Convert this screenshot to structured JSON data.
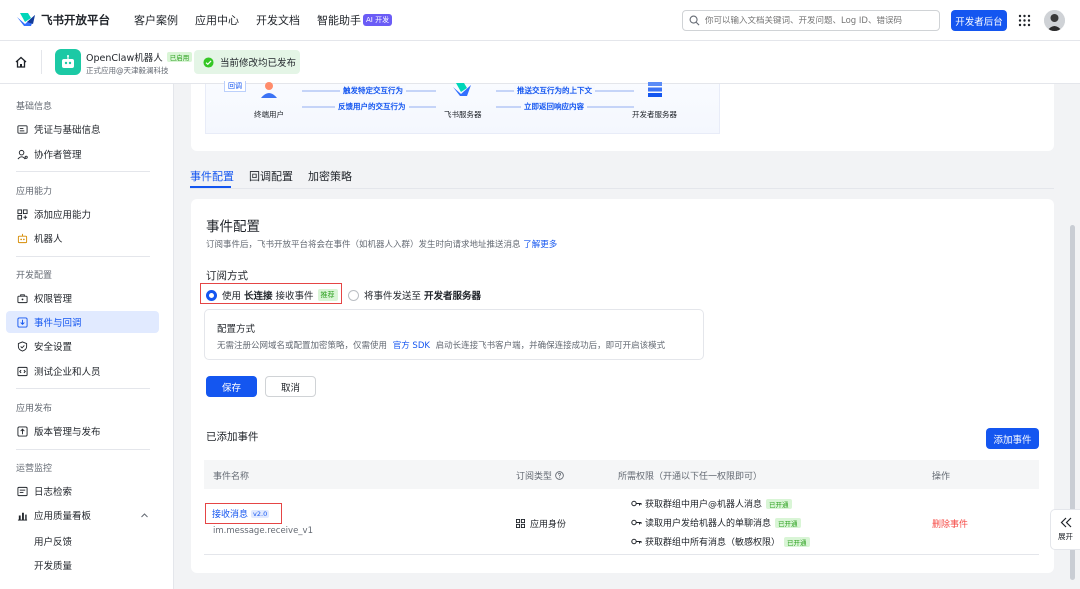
{
  "topbar": {
    "logo_text": "飞书开放平台",
    "nav": [
      "客户案例",
      "应用中心",
      "开发文档",
      "智能助手"
    ],
    "ai_badge": "AI 开发",
    "search_placeholder": "你可以输入文档关键词、开发问题、Log ID、错误码",
    "dev_console": "开发者后台"
  },
  "appbar": {
    "app_name": "OpenClaw机器人",
    "app_status": "已启用",
    "app_sub": "正式应用@天津毅澜科技",
    "publish_status": "当前修改均已发布"
  },
  "sidebar": {
    "sections": [
      {
        "title": "基础信息",
        "items": [
          "凭证与基础信息",
          "协作者管理"
        ]
      },
      {
        "title": "应用能力",
        "items": [
          "添加应用能力",
          "机器人"
        ]
      },
      {
        "title": "开发配置",
        "items": [
          "权限管理",
          "事件与回调",
          "安全设置",
          "测试企业和人员"
        ]
      },
      {
        "title": "应用发布",
        "items": [
          "版本管理与发布"
        ]
      },
      {
        "title": "运营监控",
        "items": [
          "日志检索",
          "应用质量看板"
        ]
      }
    ],
    "sub_items": [
      "用户反馈",
      "开发质量"
    ]
  },
  "diagram": {
    "corner_tag": "回调",
    "end_user": "终端用户",
    "feishu_server": "飞书服务器",
    "dev_server": "开发者服务器",
    "arrow1": "触发特定交互行为",
    "arrow2": "反馈用户的交互行为",
    "arrow3": "推送交互行为的上下文",
    "arrow4": "立即返回响应内容"
  },
  "tabs": [
    "事件配置",
    "回调配置",
    "加密策略"
  ],
  "event_config": {
    "title": "事件配置",
    "desc": "订阅事件后，飞书开放平台将会在事件（如机器人入群）发生时向请求地址推送消息",
    "learn_more": "了解更多",
    "sub_mode_label": "订阅方式",
    "opt1_pre": "使用",
    "opt1_bold": "长连接",
    "opt1_post": "接收事件",
    "opt1_tag": "推荐",
    "opt2_pre": "将事件发送至",
    "opt2_bold": "开发者服务器",
    "cfg_title": "配置方式",
    "cfg_desc_pre": "无需注册公网域名或配置加密策略，仅需使用",
    "cfg_link": "官方 SDK",
    "cfg_desc_post": "启动长连接飞书客户端，并确保连接成功后，即可开启该模式",
    "save": "保存",
    "cancel": "取消"
  },
  "added_events": {
    "title": "已添加事件",
    "add_button": "添加事件",
    "headers": [
      "事件名称",
      "订阅类型",
      "所需权限（开通以下任一权限即可）",
      "操作"
    ],
    "rows": [
      {
        "name": "接收消息",
        "version": "v2.0",
        "code": "im.message.receive_v1",
        "sub_type": "应用身份",
        "permissions": [
          {
            "name": "获取群组中用户@机器人消息",
            "status": "已开通"
          },
          {
            "name": "读取用户发给机器人的单聊消息",
            "status": "已开通"
          },
          {
            "name": "获取群组中所有消息（敏感权限）",
            "status": "已开通"
          }
        ],
        "action": "删除事件"
      }
    ]
  },
  "expand_label": "展开",
  "colors": {
    "primary": "#1456f0",
    "danger": "#f54a45",
    "success": "#2ea121"
  }
}
